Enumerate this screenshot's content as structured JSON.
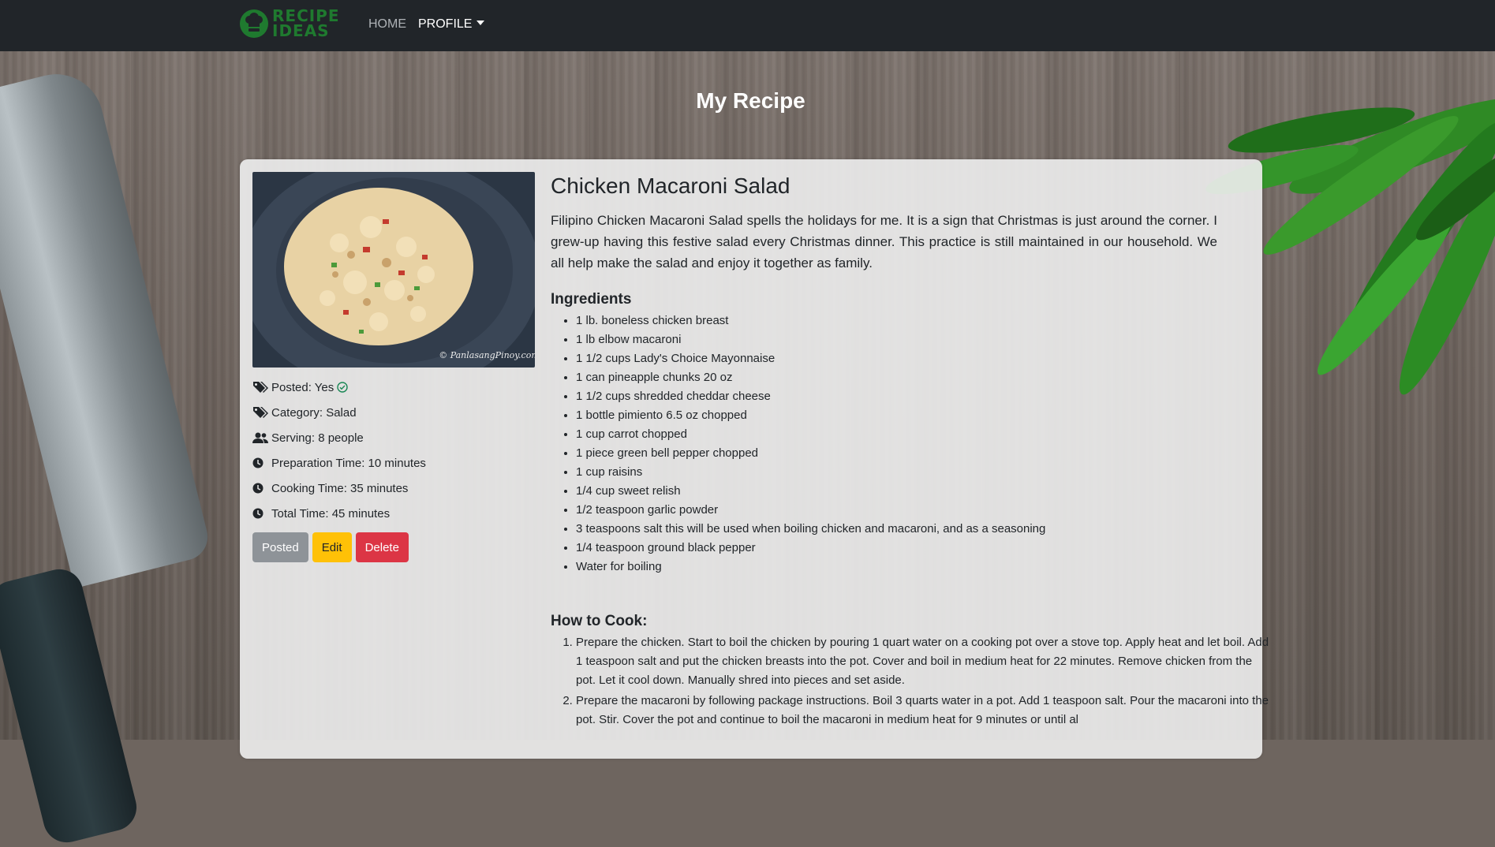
{
  "nav": {
    "brand_line1": "RECIPE",
    "brand_line2": "IDEAS",
    "home": "HOME",
    "profile": "PROFILE"
  },
  "page": {
    "title": "My Recipe"
  },
  "recipe": {
    "title": "Chicken Macaroni Salad",
    "image_watermark": "© PanlasangPinoy.com",
    "description": "Filipino Chicken Macaroni Salad spells the holidays for me. It is a sign that Christmas is just around the corner. I grew-up having this festive salad every Christmas dinner. This practice is still maintained in our household. We all help make the salad and enjoy it together as family.",
    "meta": {
      "posted": "Posted: Yes",
      "category": "Category: Salad",
      "serving": "Serving: 8 people",
      "prep": "Preparation Time: 10 minutes",
      "cook": "Cooking Time: 35 minutes",
      "total": "Total Time: 45 minutes"
    },
    "buttons": {
      "posted": "Posted",
      "edit": "Edit",
      "delete": "Delete"
    },
    "ingredients_heading": "Ingredients",
    "ingredients": [
      "1 lb. boneless chicken breast",
      "1 lb elbow macaroni",
      "1 1/2 cups Lady's Choice Mayonnaise",
      "1 can pineapple chunks 20 oz",
      "1 1/2 cups shredded cheddar cheese",
      "1 bottle pimiento 6.5 oz chopped",
      "1 cup carrot chopped",
      "1 piece green bell pepper chopped",
      "1 cup raisins",
      "1/4 cup sweet relish",
      "1/2 teaspoon garlic powder",
      "3 teaspoons salt this will be used when boiling chicken and macaroni, and as a seasoning",
      "1/4 teaspoon ground black pepper",
      "Water for boiling"
    ],
    "steps_heading": "How to Cook:",
    "steps": [
      "Prepare the chicken. Start to boil the chicken by pouring 1 quart water on a cooking pot over a stove top. Apply heat and let boil. Add 1 teaspoon salt and put the chicken breasts into the pot. Cover and boil in medium heat for 22 minutes. Remove chicken from the pot. Let it cool down. Manually shred into pieces and set aside.",
      "Prepare the macaroni by following package instructions. Boil 3 quarts water in a pot. Add 1 teaspoon salt. Pour the macaroni into the pot. Stir. Cover the pot and continue to boil the macaroni in medium heat for 9 minutes or until al"
    ]
  },
  "colors": {
    "navbar": "#212529",
    "brand": "#1f7a2f",
    "btn_posted": "#8e9398",
    "btn_edit": "#ffc107",
    "btn_delete": "#dc3545",
    "check": "#198754"
  }
}
